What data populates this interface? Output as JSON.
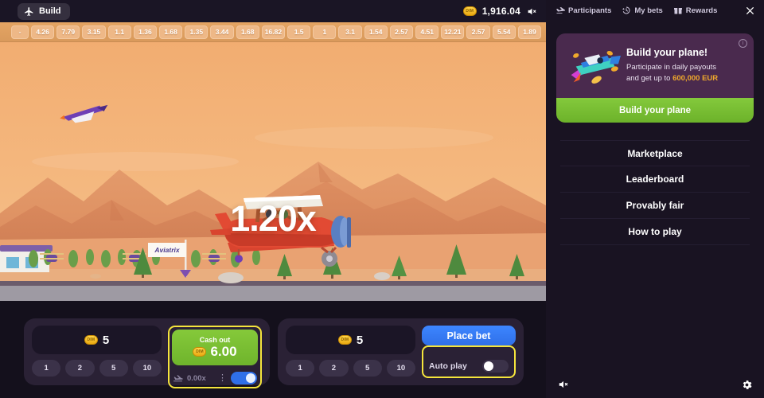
{
  "header": {
    "build_label": "Build",
    "build_icon": "plane-icon",
    "balance": "1,916.04",
    "coin_label": "DIM",
    "mute_icon": "speaker-muted-icon"
  },
  "sidebar_header": {
    "participants": "Participants",
    "participants_icon": "participants-plane-icon",
    "my_bets": "My bets",
    "my_bets_icon": "history-clock-icon",
    "rewards": "Rewards",
    "rewards_icon": "gift-icon",
    "close_icon": "close-icon"
  },
  "history": {
    "values": [
      "-",
      "4.26",
      "7.79",
      "3.15",
      "1.1",
      "1.36",
      "1.68",
      "1.35",
      "3.44",
      "1.68",
      "16.82",
      "1.5",
      "1",
      "3.1",
      "1.54",
      "2.57",
      "4.51",
      "12.21",
      "2.57",
      "5.54",
      "1.89"
    ]
  },
  "game": {
    "multiplier": "1.20x",
    "banner_text": "Aviatrix",
    "plane_icon": "red-biplane",
    "secondary_plane_icon": "purple-plane"
  },
  "bet_left": {
    "amount": "5",
    "coin_label": "DIM",
    "quick_amounts": [
      "1",
      "2",
      "5",
      "10"
    ],
    "cashout_label": "Cash out",
    "cashout_amount": "6.00",
    "auto_cashout_value": "0.00x",
    "auto_cashout_icon": "plane-landing-icon",
    "more_icon": "more-vertical-icon",
    "toggle_state": "on"
  },
  "bet_right": {
    "amount": "5",
    "coin_label": "DIM",
    "quick_amounts": [
      "1",
      "2",
      "5",
      "10"
    ],
    "place_bet_label": "Place bet",
    "autoplay_label": "Auto play",
    "toggle_state": "off"
  },
  "promo": {
    "title": "Build your plane!",
    "sub_line1": "Participate in daily payouts",
    "sub_line2_prefix": "and get up to ",
    "amount": "600,000 EUR",
    "button_label": "Build your plane",
    "info_icon": "info-icon",
    "art_icon": "plane-parts-icon"
  },
  "menu": {
    "items": [
      "Marketplace",
      "Leaderboard",
      "Provably fair",
      "How to play"
    ]
  },
  "footer": {
    "mute_icon": "speaker-muted-icon",
    "settings_icon": "gear-icon"
  },
  "colors": {
    "accent_green": "#7abd33",
    "accent_blue": "#2f6fe8",
    "highlight_yellow": "#f5e53c",
    "gold": "#f0a92c",
    "panel": "#2a2135",
    "background": "#14101c"
  }
}
